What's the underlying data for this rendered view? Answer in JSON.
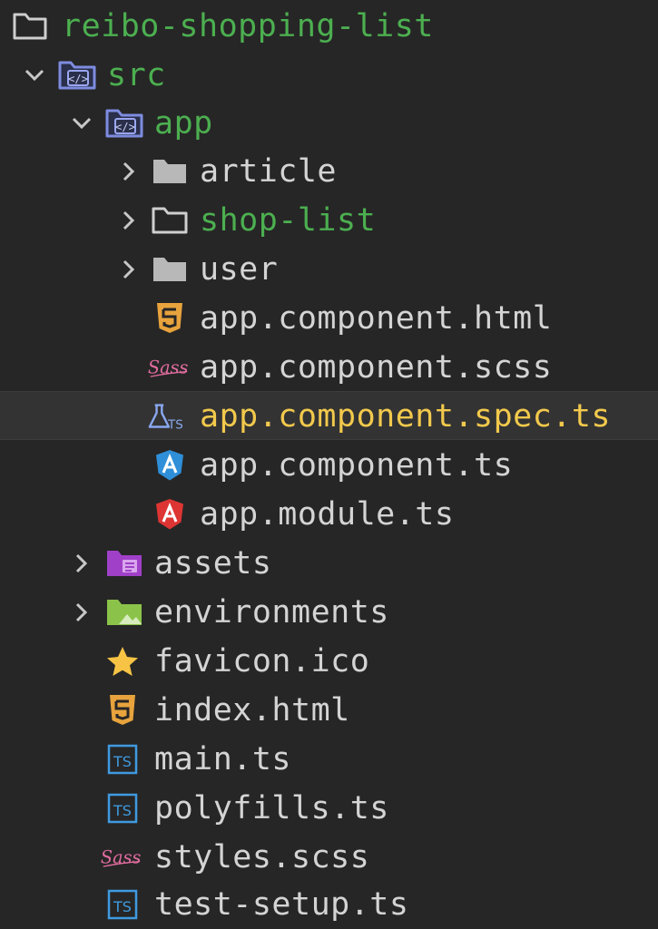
{
  "explorer": {
    "root": {
      "label": "reibo-shopping-list",
      "icon": "root-folder-icon"
    },
    "items": [
      {
        "id": "src",
        "label": "src",
        "icon": "source-folder-icon",
        "chevron": "chevron-down-icon"
      },
      {
        "id": "app",
        "label": "app",
        "icon": "source-folder-icon",
        "chevron": "chevron-down-icon"
      },
      {
        "id": "article",
        "label": "article",
        "icon": "folder-icon",
        "chevron": "chevron-right-icon"
      },
      {
        "id": "shop-list",
        "label": "shop-list",
        "icon": "folder-outline-icon",
        "chevron": "chevron-right-icon"
      },
      {
        "id": "user",
        "label": "user",
        "icon": "folder-icon",
        "chevron": "chevron-right-icon"
      },
      {
        "id": "app-component-html",
        "label": "app.component.html",
        "icon": "html5-icon"
      },
      {
        "id": "app-component-scss",
        "label": "app.component.scss",
        "icon": "sass-icon"
      },
      {
        "id": "app-component-spec-ts",
        "label": "app.component.spec.ts",
        "icon": "test-ts-icon",
        "selected": true
      },
      {
        "id": "app-component-ts",
        "label": "app.component.ts",
        "icon": "angular-component-icon"
      },
      {
        "id": "app-module-ts",
        "label": "app.module.ts",
        "icon": "angular-module-icon"
      },
      {
        "id": "assets",
        "label": "assets",
        "icon": "assets-folder-icon",
        "chevron": "chevron-right-icon"
      },
      {
        "id": "environments",
        "label": "environments",
        "icon": "environments-folder-icon",
        "chevron": "chevron-right-icon"
      },
      {
        "id": "favicon-ico",
        "label": "favicon.ico",
        "icon": "star-icon"
      },
      {
        "id": "index-html",
        "label": "index.html",
        "icon": "html5-icon"
      },
      {
        "id": "main-ts",
        "label": "main.ts",
        "icon": "typescript-icon"
      },
      {
        "id": "polyfills-ts",
        "label": "polyfills.ts",
        "icon": "typescript-icon"
      },
      {
        "id": "styles-scss",
        "label": "styles.scss",
        "icon": "sass-icon"
      },
      {
        "id": "test-setup-ts",
        "label": "test-setup.ts",
        "icon": "typescript-icon"
      }
    ]
  },
  "colors": {
    "background": "#262626",
    "selected_row": "#333333",
    "text": "#d4d4d4",
    "modified_green": "#4caf50",
    "selected_yellow": "#f2c94c",
    "icon_grey": "#cfcfcf",
    "chevron": "#c8c8c8",
    "source_folder_blue": "#7e8ce0",
    "html5_orange": "#e8a33d",
    "sass_pink": "#e06c9f",
    "typescript_blue": "#3f9ae0",
    "angular_blue": "#2f8fd8",
    "angular_red": "#dd3434",
    "assets_purple": "#a040c8",
    "environments_green": "#8bc34a",
    "star_yellow": "#f6c344"
  }
}
